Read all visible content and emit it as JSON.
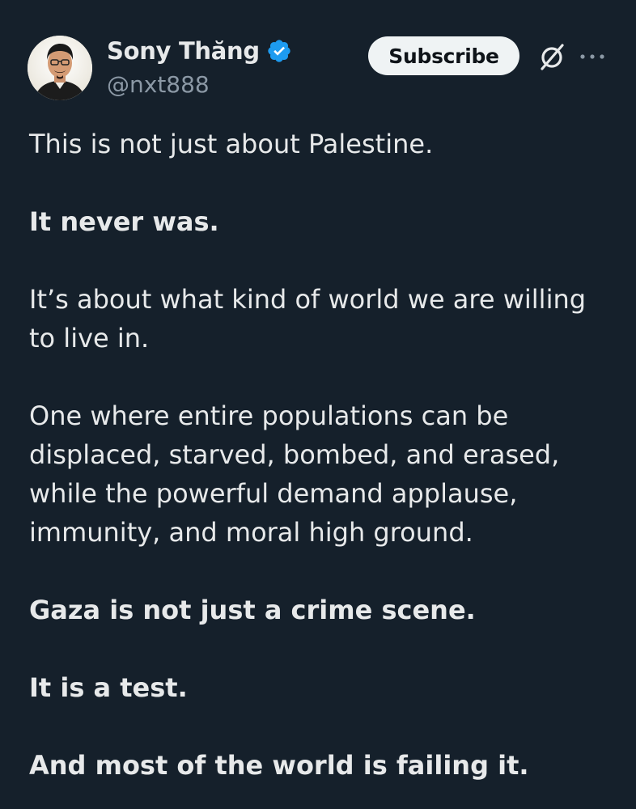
{
  "author": {
    "display_name": "Sony Thăng",
    "handle": "@nxt888",
    "verified": true
  },
  "actions": {
    "subscribe_label": "Subscribe",
    "grok_icon": "grok-icon",
    "more_icon": "more-icon"
  },
  "tweet": {
    "paragraphs": [
      {
        "text": "This is not just about Palestine.",
        "bold": false
      },
      {
        "text": "It never was.",
        "bold": true
      },
      {
        "text": "It’s about what kind of world we are willing to live in.",
        "bold": false
      },
      {
        "text": "One where entire populations can be displaced, starved, bombed, and erased, while the powerful demand applause, immunity, and moral high ground.",
        "bold": false
      },
      {
        "text": "Gaza is not just a crime scene.",
        "bold": true
      },
      {
        "text": "It is a test.",
        "bold": true
      },
      {
        "text": "And most of the world is failing it.",
        "bold": true
      }
    ]
  },
  "colors": {
    "background": "#15202b",
    "text_primary": "#e7e9ea",
    "text_secondary": "#8b98a5",
    "verified_blue": "#1d9bf0",
    "button_bg": "#eff3f4",
    "button_text": "#0f1419"
  }
}
